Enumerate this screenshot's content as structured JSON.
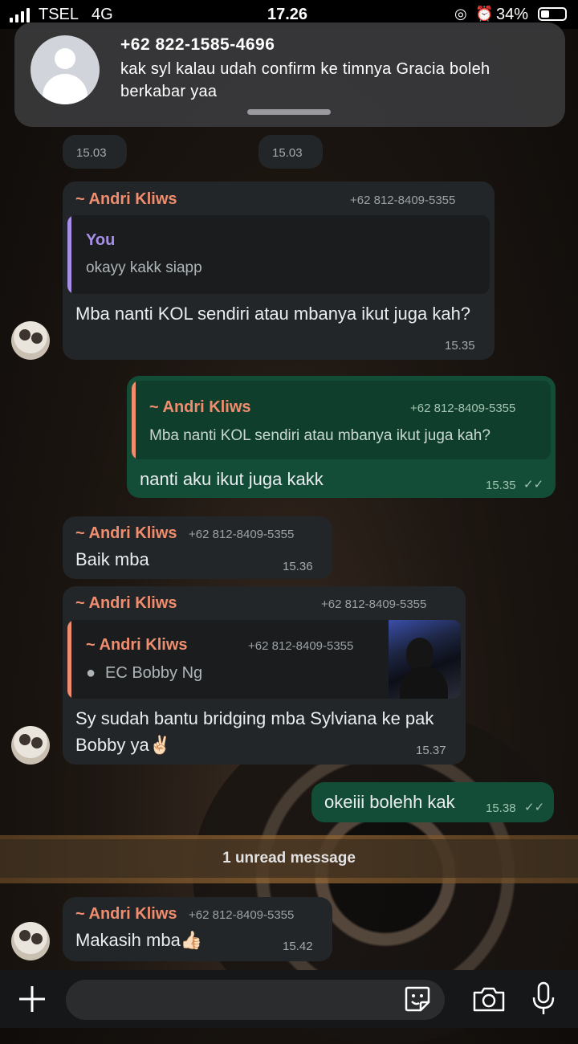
{
  "status_bar": {
    "carrier": "TSEL",
    "network": "4G",
    "time": "17.26",
    "battery": "34%"
  },
  "notification": {
    "sender": "+62 822-1585-4696",
    "text": "kak syl kalau udah confirm ke timnya Gracia boleh berkabar yaa"
  },
  "messages": [
    {
      "time_a": "15.03",
      "time_b": "15.03"
    },
    {
      "sender": "~ Andri Kliws",
      "phone": "+62 812-8409-5355",
      "quote_sender": "You",
      "quote_text": "okayy kakk siapp",
      "text": "Mba nanti KOL sendiri atau mbanya ikut juga kah?",
      "time": "15.35"
    },
    {
      "quote_sender": "~ Andri Kliws",
      "quote_phone": "+62 812-8409-5355",
      "quote_text": "Mba nanti KOL sendiri atau mbanya ikut juga kah?",
      "text": "nanti aku ikut juga kakk",
      "time": "15.35"
    },
    {
      "sender": "~ Andri Kliws",
      "phone": "+62 812-8409-5355",
      "text": "Baik mba",
      "time": "15.36"
    },
    {
      "sender": "~ Andri Kliws",
      "phone": "+62 812-8409-5355",
      "quote_sender": "~ Andri Kliws",
      "quote_phone": "+62 812-8409-5355",
      "quote_contact": "EC Bobby Ng",
      "text": "Sy sudah bantu bridging mba Sylviana ke pak Bobby ya✌🏻",
      "time": "15.37"
    },
    {
      "text": "okeiii bolehh kak",
      "time": "15.38"
    },
    {
      "sender": "~ Andri Kliws",
      "phone": "+62 812-8409-5355",
      "text": "Makasih mba👍🏻",
      "time": "15.42"
    }
  ],
  "unread_divider": "1 unread message",
  "colors": {
    "incoming": "#232628",
    "outgoing": "#134d37",
    "sender_name": "#f08d6e",
    "you_name": "#a88ee8"
  },
  "icons": [
    "plus-icon",
    "sticker-icon",
    "camera-icon",
    "microphone-icon",
    "read-receipt-icon",
    "contact-icon"
  ]
}
